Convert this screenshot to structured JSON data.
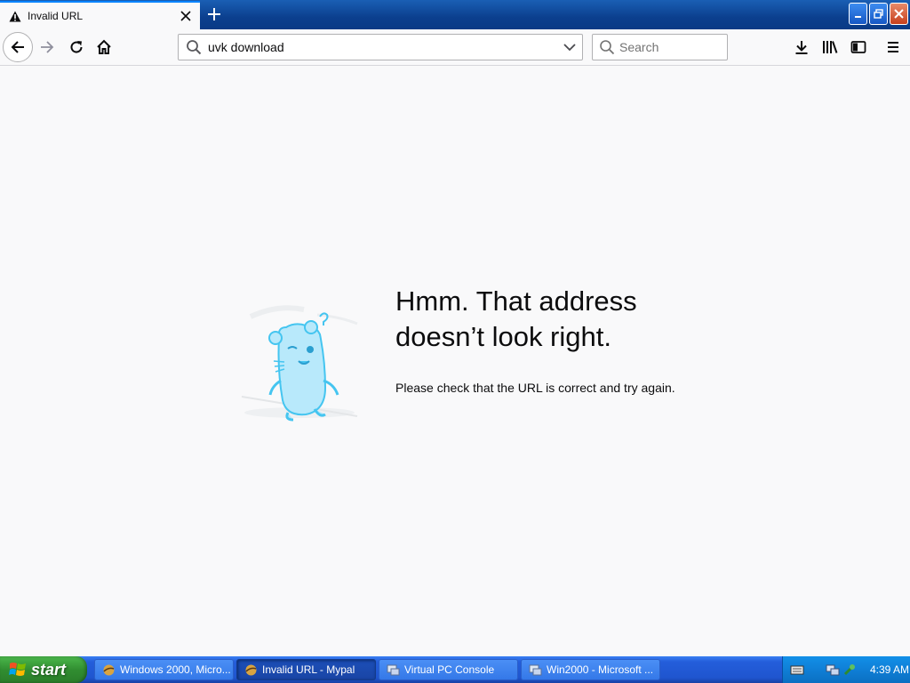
{
  "tab": {
    "title": "Invalid URL",
    "icon": "warning-icon"
  },
  "toolbar": {
    "url_value": "uvk download",
    "search_placeholder": "Search"
  },
  "error": {
    "title_line1": "Hmm. That address",
    "title_line2": "doesn’t look right.",
    "description": "Please check that the URL is correct and try again."
  },
  "taskbar": {
    "start_label": "start",
    "tasks": [
      {
        "label": "Windows 2000, Micro...",
        "icon": "browser-icon",
        "active": false
      },
      {
        "label": "Invalid URL - Mypal",
        "icon": "browser-icon",
        "active": true
      },
      {
        "label": "Virtual PC Console",
        "icon": "virtual-pc-icon",
        "active": false
      },
      {
        "label": "Win2000 - Microsoft ...",
        "icon": "virtual-pc-icon",
        "active": false
      }
    ],
    "clock": "4:39 AM"
  },
  "colors": {
    "accent": "#0a84ff",
    "illustration": "#45c5f0",
    "taskbar": "#245edb",
    "start": "#318e31"
  }
}
